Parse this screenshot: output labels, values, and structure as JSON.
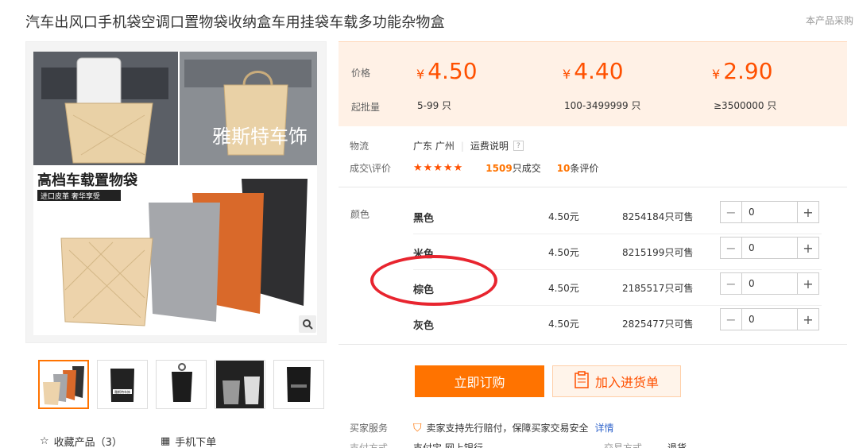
{
  "header": {
    "title": "汽车出风口手机袋空调口置物袋收纳盒车用挂袋车载多功能杂物盒",
    "right_note": "本产品采购"
  },
  "gallery": {
    "watermark": "雅斯特车饰",
    "banner_title": "高档车载置物袋",
    "banner_subtitle": "进口皮革 奢华享受",
    "thumb_label": "雅斯特车饰",
    "actions": {
      "favorite": "收藏产品（3）",
      "mobile": "手机下单"
    }
  },
  "pricing": {
    "price_label": "价格",
    "moq_label": "起批量",
    "currency": "¥",
    "tiers": [
      {
        "price": "4.50",
        "qty": "5-99 只"
      },
      {
        "price": "4.40",
        "qty": "100-3499999 只"
      },
      {
        "price": "2.90",
        "qty": "≥3500000 只"
      }
    ]
  },
  "logistics": {
    "label": "物流",
    "location": "广东 广州",
    "shipping_link": "运费说明",
    "help": "?"
  },
  "deals": {
    "label": "成交\\评价",
    "stars": "★★★★★",
    "sold_count": "1509",
    "sold_suffix": "只成交",
    "review_count": "10",
    "review_suffix": "条评价"
  },
  "sku": {
    "label": "颜色",
    "rows": [
      {
        "name": "黑色",
        "price": "4.50元",
        "stock": "8254184只可售",
        "qty": "0"
      },
      {
        "name": "米色",
        "price": "4.50元",
        "stock": "8215199只可售",
        "qty": "0"
      },
      {
        "name": "棕色",
        "price": "4.50元",
        "stock": "2185517只可售",
        "qty": "0"
      },
      {
        "name": "灰色",
        "price": "4.50元",
        "stock": "2825477只可售",
        "qty": "0"
      }
    ]
  },
  "buttons": {
    "order": "立即订购",
    "cart": "加入进货单"
  },
  "service": {
    "label": "买家服务",
    "text": "卖家支持先行赔付，保障买家交易安全",
    "link": "详情"
  },
  "cut_off": {
    "left": "支付方式",
    "mid": "支付宝  网上银行",
    "right": "交易方式",
    "right_val": "退货"
  },
  "colors": {
    "accent": "#ff7300",
    "price": "#ff5000",
    "highlight": "#e8252f"
  }
}
